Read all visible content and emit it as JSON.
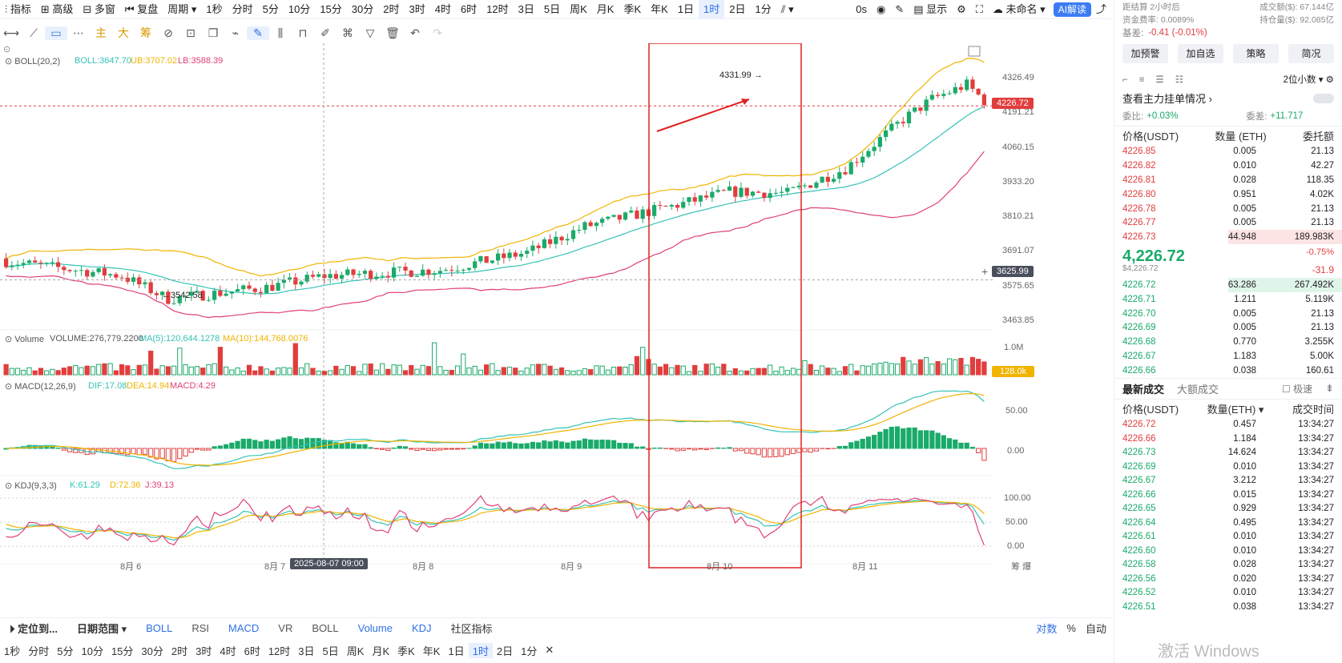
{
  "topbar": {
    "items": [
      "指标",
      "高级",
      "多窗",
      "复盘",
      "周期",
      "1秒",
      "分时",
      "5分",
      "10分",
      "15分",
      "30分",
      "2时",
      "3时",
      "4时",
      "6时",
      "12时",
      "3日",
      "5日",
      "周K",
      "月K",
      "季K",
      "年K",
      "1日",
      "1时",
      "2日",
      "1分"
    ],
    "active": "1时",
    "right_items": [
      "0s",
      "显示",
      "未命名",
      "AI解读"
    ]
  },
  "toolbar2": {
    "indicator_tabs": [
      "主",
      "大",
      "筹"
    ]
  },
  "price_axis": {
    "ticks": [
      "4326.49",
      "4191.21",
      "4060.15",
      "3933.20",
      "3810.21",
      "3691.07",
      "3575.65",
      "3463.85"
    ],
    "current": "4226.72",
    "crosshair": "3625.99",
    "high_label": "4331.99",
    "low_label": "3542.58"
  },
  "indicators": {
    "boll": {
      "name": "BOLL(20,2)",
      "boll": "BOLL:3647.70",
      "ub": "UB:3707.02",
      "lb": "LB:3588.39"
    },
    "volume": {
      "name": "Volume",
      "value": "VOLUME:276,779.2200",
      "ma5": "MA(5):120,644.1278",
      "ma10": "MA(10):144,768.0076",
      "axis_top": "1.0M",
      "current": "128.0k"
    },
    "macd": {
      "name": "MACD(12,26,9)",
      "dif": "DIF:17.08",
      "dea": "DEA:14.94",
      "macd": "MACD:4.29",
      "ticks": [
        "50.00",
        "0.00"
      ]
    },
    "kdj": {
      "name": "KDJ(9,3,3)",
      "k": "K:61.29",
      "d": "D:72.36",
      "j": "J:39.13",
      "ticks": [
        "100.00",
        "50.00",
        "0.00"
      ]
    }
  },
  "x_axis": {
    "labels": [
      "8月 6",
      "8月 7",
      "8月 8",
      "8月 9",
      "8月 10",
      "8月 11"
    ],
    "crosshair_date": "2025-08-07 09:00"
  },
  "bottom_bar1": {
    "items": [
      "定位到...",
      "日期范围",
      "BOLL",
      "RSI",
      "MACD",
      "VR",
      "BOLL",
      "Volume",
      "KDJ",
      "社区指标"
    ],
    "right": [
      "对数",
      "%",
      "自动"
    ]
  },
  "bottom_bar2": {
    "items": [
      "1秒",
      "分时",
      "5分",
      "10分",
      "15分",
      "30分",
      "2时",
      "3时",
      "4时",
      "6时",
      "12时",
      "3日",
      "5日",
      "周K",
      "月K",
      "季K",
      "年K",
      "1日",
      "1时",
      "2日",
      "1分"
    ],
    "active": "1时"
  },
  "right_panel": {
    "info": [
      [
        "距结算",
        "2小时后",
        "成交额($):",
        "67.144亿"
      ],
      [
        "资金费率:",
        "0.0089%",
        "持仓量($):",
        "92.085亿"
      ]
    ],
    "basis_label": "基差:",
    "basis_value": "-0.41 (-0.01%)",
    "buttons": [
      "加预警",
      "加自选",
      "策略",
      "简况"
    ],
    "decimals": "2位小数",
    "main_orders": "查看主力挂单情况",
    "ratio_label": "委比:",
    "ratio_value": "+0.03%",
    "diff_label": "委差:",
    "diff_value": "+11.717",
    "book_head": [
      "价格(USDT)",
      "数量 (ETH)",
      "委托额"
    ],
    "asks": [
      [
        "4226.85",
        "0.005",
        "21.13"
      ],
      [
        "4226.82",
        "0.010",
        "42.27"
      ],
      [
        "4226.81",
        "0.028",
        "118.35"
      ],
      [
        "4226.80",
        "0.951",
        "4.02K"
      ],
      [
        "4226.78",
        "0.005",
        "21.13"
      ],
      [
        "4226.77",
        "0.005",
        "21.13"
      ],
      [
        "4226.73",
        "44.948",
        "189.983K"
      ]
    ],
    "last_price": "4,226.72",
    "last_price_usd": "$4,226.72",
    "change_pct": "-0.75%",
    "change": "-31.9",
    "bids": [
      [
        "4226.72",
        "63.286",
        "267.492K"
      ],
      [
        "4226.71",
        "1.211",
        "5.119K"
      ],
      [
        "4226.70",
        "0.005",
        "21.13"
      ],
      [
        "4226.69",
        "0.005",
        "21.13"
      ],
      [
        "4226.68",
        "0.770",
        "3.255K"
      ],
      [
        "4226.67",
        "1.183",
        "5.00K"
      ],
      [
        "4226.66",
        "0.038",
        "160.61"
      ]
    ],
    "trade_tabs": [
      "最新成交",
      "大额成交"
    ],
    "fast_label": "极速",
    "trade_head": [
      "价格(USDT)",
      "数量(ETH)",
      "成交时间"
    ],
    "trades": [
      [
        "4226.72",
        "0.457",
        "13:34:27",
        "r"
      ],
      [
        "4226.66",
        "1.184",
        "13:34:27",
        "r"
      ],
      [
        "4226.73",
        "14.624",
        "13:34:27",
        "g"
      ],
      [
        "4226.69",
        "0.010",
        "13:34:27",
        "g"
      ],
      [
        "4226.67",
        "3.212",
        "13:34:27",
        "g"
      ],
      [
        "4226.66",
        "0.015",
        "13:34:27",
        "g"
      ],
      [
        "4226.65",
        "0.929",
        "13:34:27",
        "g"
      ],
      [
        "4226.64",
        "0.495",
        "13:34:27",
        "g"
      ],
      [
        "4226.61",
        "0.010",
        "13:34:27",
        "g"
      ],
      [
        "4226.60",
        "0.010",
        "13:34:27",
        "g"
      ],
      [
        "4226.58",
        "0.028",
        "13:34:27",
        "g"
      ],
      [
        "4226.56",
        "0.020",
        "13:34:27",
        "g"
      ],
      [
        "4226.52",
        "0.010",
        "13:34:27",
        "g"
      ],
      [
        "4226.51",
        "0.038",
        "13:34:27",
        "g"
      ]
    ]
  },
  "watermark": "激活 Windows",
  "colors": {
    "up": "#1aaa6a",
    "down": "#e23d3d",
    "ub": "#f0b400",
    "mid": "#35c3b6",
    "lb": "#e0407a",
    "highlight": "#e02020"
  }
}
